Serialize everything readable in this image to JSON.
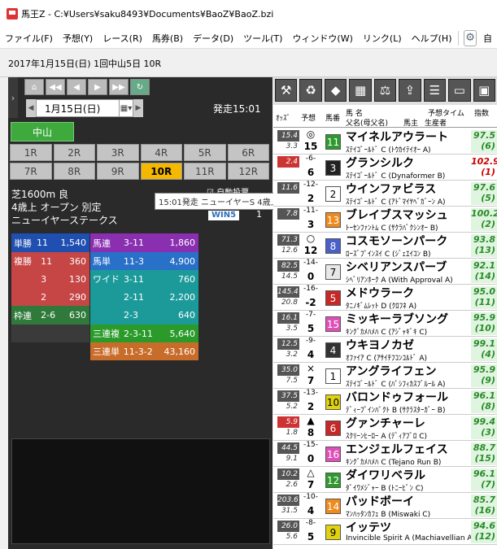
{
  "window": {
    "title": "馬王Z - C:¥Users¥saku8493¥Documents¥BaoZ¥BaoZ.bzi"
  },
  "menu": {
    "items": [
      "ファイル(F)",
      "予想(Y)",
      "レース(R)",
      "馬券(B)",
      "データ(D)",
      "ツール(T)",
      "ウィンドウ(W)",
      "リンク(L)",
      "ヘルプ(H)"
    ],
    "extra": "自"
  },
  "race_header": "2017年1月15日(日) 1回中山5日 10R",
  "nav": {
    "date": "1月15日(日)",
    "start_time": "発走15:01",
    "venue": "中山"
  },
  "races": [
    "1R",
    "2R",
    "3R",
    "4R",
    "5R",
    "6R",
    "7R",
    "8R",
    "9R",
    "10R",
    "11R",
    "12R"
  ],
  "active_race": "10R",
  "race_info": {
    "track": "芝1600m 良",
    "class": "4歳上 オープン 別定",
    "name": "ニューイヤーステークス",
    "tooltip": "15:01発走 ニューイヤーS 4歳上 オープン",
    "auto_label": "自動投票",
    "win5_label": "WIN5",
    "win5_num": "1"
  },
  "payouts": {
    "tansho": {
      "label": "単勝",
      "combo": "11",
      "amount": "1,540"
    },
    "fukusho": {
      "label": "複勝",
      "rows": [
        {
          "combo": "11",
          "amount": "360"
        },
        {
          "combo": "3",
          "amount": "130"
        },
        {
          "combo": "2",
          "amount": "290"
        }
      ]
    },
    "wakuren": {
      "label": "枠連",
      "combo": "2-6",
      "amount": "630"
    },
    "umaren": {
      "label": "馬連",
      "combo": "3-11",
      "amount": "1,860"
    },
    "umatan": {
      "label": "馬単",
      "combo": "11-3",
      "amount": "4,900"
    },
    "wide": {
      "label": "ワイド",
      "rows": [
        {
          "combo": "3-11",
          "amount": "760"
        },
        {
          "combo": "2-11",
          "amount": "2,200"
        },
        {
          "combo": "2-3",
          "amount": "640"
        }
      ]
    },
    "sanrenpuku": {
      "label": "三連複",
      "combo": "2-3-11",
      "amount": "5,640"
    },
    "sanrentan": {
      "label": "三連単",
      "combo": "11-3-2",
      "amount": "43,160"
    }
  },
  "table_header": {
    "odds": "ｵｯｽﾞ",
    "mark": "予想",
    "num": "馬番",
    "name": "馬 名",
    "sire": "父名(母父名)",
    "owner": "馬主",
    "breeder": "生産者",
    "time": "予想タイム",
    "index": "指数"
  },
  "horses": [
    {
      "odds": "15.4",
      "pop": "3.3",
      "mark": "◎",
      "diff": "15",
      "num": "11",
      "color": "#2e9a2e",
      "name": "マイネルアウラート",
      "ped": "ｽﾃｲｺﾞｰﾙﾄﾞ C (ﾄｳｶｲﾃｲｵｰ A)",
      "time": "97.5",
      "rank": "(6)",
      "red": false,
      "hot": false
    },
    {
      "odds": "2.4",
      "pop": "",
      "mark": "-6-",
      "diff": "6",
      "num": "3",
      "color": "#222222",
      "name": "グランシルク",
      "ped": "ｽﾃｲｺﾞｰﾙﾄﾞ C (Dynaformer B)",
      "time": "102.9",
      "rank": "(1)",
      "red": true,
      "hot": true
    },
    {
      "odds": "11.6",
      "pop": "",
      "mark": "-12-",
      "diff": "2",
      "num": "2",
      "color": "#ffffff",
      "name": "ウインファビラス",
      "ped": "ｽﾃｲｺﾞｰﾙﾄﾞ C (ｱﾄﾞﾏｲﾔﾍﾞｶﾞｰﾝ A)",
      "time": "97.6",
      "rank": "(5)",
      "red": false,
      "hot": false
    },
    {
      "odds": "7.8",
      "pop": "",
      "mark": "-11-",
      "diff": "3",
      "num": "13",
      "color": "#ef8a1c",
      "name": "ブレイブスマッシュ",
      "ped": "ﾄｰｾﾝﾌｧﾝﾄﾑ C (ｻｸﾗﾊﾞｸｼﾝｵｰ B)",
      "time": "100.2",
      "rank": "(2)",
      "red": false,
      "hot": false
    },
    {
      "odds": "71.3",
      "pop": "12.6",
      "mark": "○",
      "diff": "12",
      "num": "8",
      "color": "#4a5fc8",
      "name": "コスモソーンパーク",
      "ped": "ﾛｰｽﾞﾌﾟｲﾝｽｲ C (ｼﾞｪｴｲｺﾝ B)",
      "time": "93.8",
      "rank": "(13)",
      "red": false,
      "hot": false
    },
    {
      "odds": "82.5",
      "pop": "14.5",
      "mark": "-14-",
      "diff": "0",
      "num": "7",
      "color": "#e8e8e8",
      "name": "シベリアンスパーブ",
      "ped": "ｼﾍﾞﾘｱﾝﾎｰｸ A (With Approval A)",
      "time": "92.1",
      "rank": "(14)",
      "red": false,
      "hot": false
    },
    {
      "odds": "145.4",
      "pop": "20.8",
      "mark": "-16-",
      "diff": "-2",
      "num": "5",
      "color": "#c62828",
      "name": "メドウラーク",
      "ped": "ﾀﾆﾉｷﾞﾑﾚｯﾄ D (ｸﾛﾌﾈ A)",
      "time": "95.0",
      "rank": "(11)",
      "red": false,
      "hot": false
    },
    {
      "odds": "16.1",
      "pop": "3.5",
      "mark": "-7-",
      "diff": "5",
      "num": "15",
      "color": "#e04fb8",
      "name": "ミッキーラブソング",
      "ped": "ｷﾝｸﾞｶﾒﾊﾒﾊ C (ｱｼﾞｬｷﾞｷ C)",
      "time": "95.9",
      "rank": "(10)",
      "red": false,
      "hot": false
    },
    {
      "odds": "12.5",
      "pop": "3.2",
      "mark": "-9-",
      "diff": "4",
      "num": "4",
      "color": "#333333",
      "name": "ウキヨノカゼ",
      "ped": "ｵﾌｧｲｱ C (ｱｻｲﾁﾌｺﾝｺﾙﾄﾞ A)",
      "time": "99.1",
      "rank": "(4)",
      "red": false,
      "hot": false
    },
    {
      "odds": "35.0",
      "pop": "7.5",
      "mark": "×",
      "diff": "7",
      "num": "1",
      "color": "#ffffff",
      "name": "アングライフェン",
      "ped": "ｽﾃｲｺﾞｰﾙﾄﾞ C (ﾊﾟｼﾌｨｶｽﾌﾞﾙｰﾙ A)",
      "time": "95.9",
      "rank": "(9)",
      "red": false,
      "hot": false
    },
    {
      "odds": "37.5",
      "pop": "5.2",
      "mark": "-13-",
      "diff": "2",
      "num": "10",
      "color": "#e0d20f",
      "name": "バロンドゥフォール",
      "ped": "ﾃﾞｨｰﾌﾟｲﾝﾊﾟｸﾄ B (ｻｸﾗｽﾀｰｶﾞｰ B)",
      "time": "96.1",
      "rank": "(8)",
      "red": false,
      "hot": false
    },
    {
      "odds": "5.9",
      "pop": "1.8",
      "mark": "▲",
      "diff": "8",
      "num": "6",
      "color": "#c62828",
      "name": "グァンチャーレ",
      "ped": "ｽｸﾘｰﾝﾋｰﾛｰ A (ﾃﾞｨｱﾌﾞﾛ C)",
      "time": "99.4",
      "rank": "(3)",
      "red": false,
      "hot": true
    },
    {
      "odds": "44.5",
      "pop": "9.1",
      "mark": "-15-",
      "diff": "0",
      "num": "16",
      "color": "#e04fb8",
      "name": "エンジェルフェイス",
      "ped": "ｷﾝｸﾞｶﾒﾊﾒﾊ C (Tejano Run B)",
      "time": "88.7",
      "rank": "(15)",
      "red": false,
      "hot": false
    },
    {
      "odds": "10.2",
      "pop": "2.6",
      "mark": "△",
      "diff": "7",
      "num": "12",
      "color": "#2e9a2e",
      "name": "ダイワリベラル",
      "ped": "ﾀﾞｲﾜﾒｼﾞｬｰ B (ﾄﾆｰﾋﾞﾝ C)",
      "time": "96.1",
      "rank": "(7)",
      "red": false,
      "hot": false
    },
    {
      "odds": "203.6",
      "pop": "31.5",
      "mark": "-10-",
      "diff": "4",
      "num": "14",
      "color": "#ef8a1c",
      "name": "パッドボーイ",
      "ped": "ﾏﾝﾊｯﾀﾝｶﾌｪ B (Miswaki C)",
      "time": "85.7",
      "rank": "(16)",
      "red": false,
      "hot": false
    },
    {
      "odds": "26.0",
      "pop": "5.6",
      "mark": "-8-",
      "diff": "5",
      "num": "9",
      "color": "#e0d20f",
      "name": "イッテツ",
      "ped": "Invincible Spirit A (Machiavellian A)",
      "time": "94.6",
      "rank": "(12)",
      "red": false,
      "hot": false
    }
  ]
}
